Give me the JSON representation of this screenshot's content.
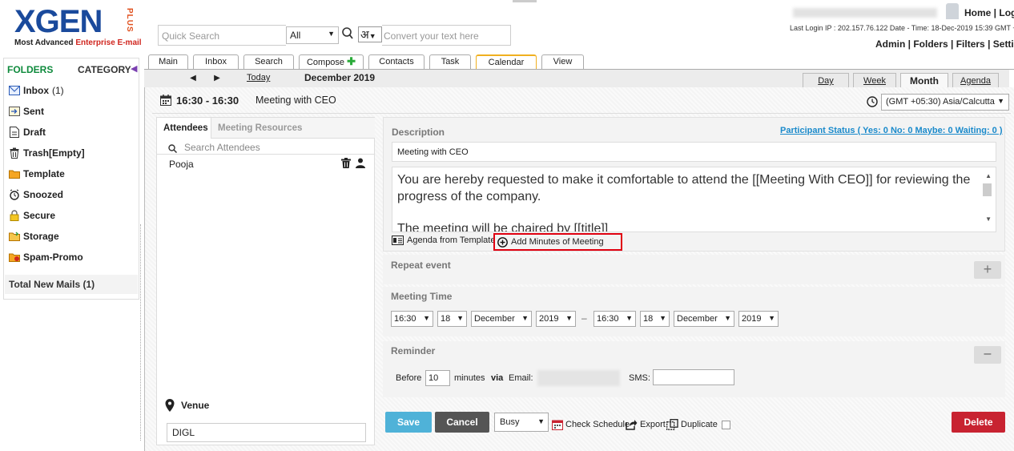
{
  "header": {
    "logo_text": "XGEN",
    "logo_plus": "PLUS",
    "logo_tagline_a": "Most Advanced ",
    "logo_tagline_b": "Enterprise E-mail",
    "quick_search_placeholder": "Quick Search",
    "scope_value": "All",
    "lang_glyph": "अ",
    "convert_placeholder": "Convert your text here",
    "top_links": "Home | Log",
    "login_info": "Last Login IP : 202.157.76.122 Date - Time: 18-Dec-2019 15:39 GMT +",
    "admin_links": "Admin | Folders | Filters | Setti"
  },
  "sidebar": {
    "folders_label": "FOLDERS",
    "category_label": "CATEGORY",
    "items": [
      {
        "label": "Inbox",
        "count": "(1)",
        "icon": "inbox-icon"
      },
      {
        "label": "Sent",
        "count": "",
        "icon": "sent-icon"
      },
      {
        "label": "Draft",
        "count": "",
        "icon": "draft-icon"
      },
      {
        "label": "Trash[Empty]",
        "count": "",
        "icon": "trash-icon"
      },
      {
        "label": "Template",
        "count": "",
        "icon": "template-folder-icon"
      },
      {
        "label": "Snoozed",
        "count": "",
        "icon": "snooze-icon"
      },
      {
        "label": "Secure",
        "count": "",
        "icon": "lock-icon"
      },
      {
        "label": "Storage",
        "count": "",
        "icon": "storage-icon"
      },
      {
        "label": "Spam-Promo",
        "count": "",
        "icon": "spam-icon"
      }
    ],
    "total_new_mails": "Total New Mails (1)"
  },
  "tabs": [
    {
      "label": "Main"
    },
    {
      "label": "Inbox"
    },
    {
      "label": "Search"
    },
    {
      "label": "Compose"
    },
    {
      "label": "Contacts"
    },
    {
      "label": "Task"
    },
    {
      "label": "Calendar"
    },
    {
      "label": "View"
    }
  ],
  "calendar_bar": {
    "prev": "◀",
    "next": "▶",
    "today": "Today",
    "month": "December 2019",
    "views": [
      "Day",
      "Week",
      "Month",
      "Agenda"
    ]
  },
  "event": {
    "time": "16:30 - 16:30",
    "title": "Meeting with CEO",
    "timezone": "(GMT +05:30) Asia/Calcutta"
  },
  "attendees": {
    "tab_attendees": "Attendees",
    "tab_resources": "Meeting Resources",
    "search_placeholder": "Search Attendees",
    "list": [
      "Pooja"
    ],
    "venue_label": "Venue",
    "venue_value": "DIGL"
  },
  "form": {
    "description_label": "Description",
    "participant_status": "Participant Status ( Yes: 0 No: 0 Maybe: 0 Waiting: 0 )",
    "description_title": "Meeting with CEO",
    "description_body": "You are hereby requested to make it comfortable to attend the [[Meeting With CEO]] for reviewing the progress of the company.",
    "description_body_cut": "The meeting will be chaired by [[title]]",
    "agenda_from_template": "Agenda from Template",
    "add_minutes": "Add Minutes of Meeting",
    "repeat_label": "Repeat event",
    "repeat_toggle": "+",
    "meeting_time_label": "Meeting Time",
    "start": {
      "time": "16:30",
      "day": "18",
      "month": "December",
      "year": "2019"
    },
    "dash": "–",
    "end": {
      "time": "16:30",
      "day": "18",
      "month": "December",
      "year": "2019"
    },
    "reminder_label": "Reminder",
    "reminder_toggle": "–",
    "before_label": "Before",
    "before_value": "10",
    "minutes_label": "minutes",
    "via_label": "via",
    "email_label": "Email:",
    "sms_label": "SMS:"
  },
  "actions": {
    "save": "Save",
    "cancel": "Cancel",
    "status": "Busy",
    "check_schedule": "Check Schedule",
    "export": "Export",
    "duplicate": "Duplicate",
    "delete": "Delete"
  },
  "colors": {
    "accent_green": "#0e8a3c",
    "save_blue": "#4fb2d8",
    "delete_red": "#c82331",
    "highlight_red": "#e00010",
    "link_blue": "#1a8acb"
  }
}
